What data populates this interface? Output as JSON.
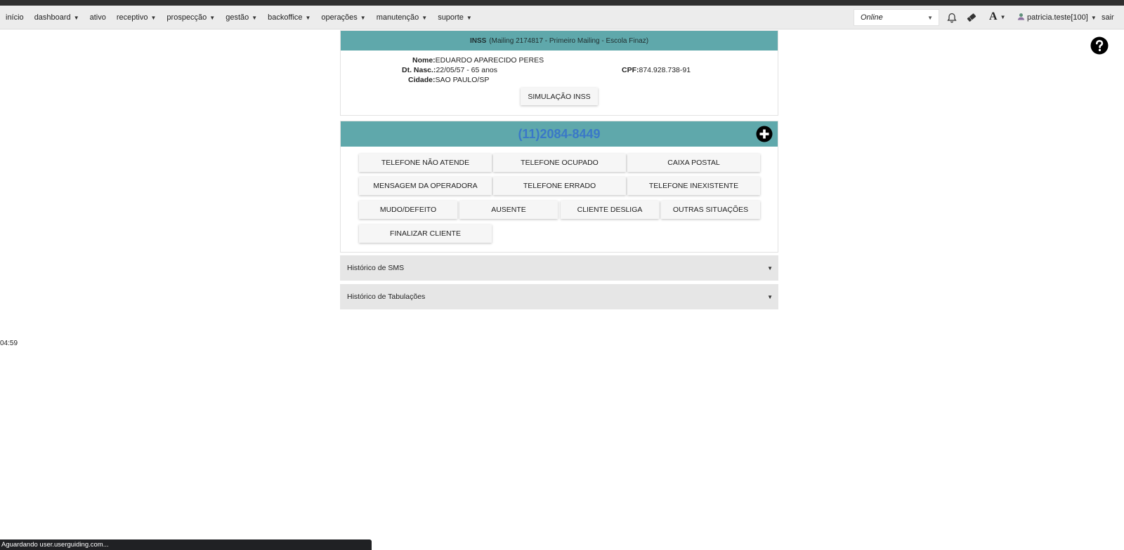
{
  "nav": {
    "items": [
      {
        "label": "início",
        "caret": false
      },
      {
        "label": "dashboard",
        "caret": true
      },
      {
        "label": "ativo",
        "caret": false
      },
      {
        "label": "receptivo",
        "caret": true
      },
      {
        "label": "prospecção",
        "caret": true
      },
      {
        "label": "gestão",
        "caret": true
      },
      {
        "label": "backoffice",
        "caret": true
      },
      {
        "label": "operações",
        "caret": true
      },
      {
        "label": "manutenção",
        "caret": true
      },
      {
        "label": "suporte",
        "caret": true
      }
    ],
    "status": "Online",
    "font_label": "A",
    "user": "patricia.teste[100]",
    "logout": "sair"
  },
  "client_card": {
    "title": "INSS",
    "subtitle": "(Mailing 2174817 - Primeiro Mailing - Escola Finaz)",
    "name_label": "Nome:",
    "name": "EDUARDO APARECIDO PERES",
    "birth_label": "Dt. Nasc.:",
    "birth": "22/05/57 - 65 anos",
    "city_label": "Cidade:",
    "city": "SAO PAULO/SP",
    "cpf_label": "CPF:",
    "cpf": "874.928.738-91",
    "simulate_button": "SIMULAÇÃO INSS"
  },
  "phone_card": {
    "number": "(11)2084-8449",
    "buttons": {
      "no_answer": "TELEFONE NÃO ATENDE",
      "busy": "TELEFONE OCUPADO",
      "voicemail": "CAIXA POSTAL",
      "operator_msg": "MENSAGEM DA OPERADORA",
      "wrong": "TELEFONE ERRADO",
      "nonexistent": "TELEFONE INEXISTENTE",
      "mute": "MUDO/DEFEITO",
      "absent": "AUSENTE",
      "hangup": "CLIENTE DESLIGA",
      "other": "OUTRAS SITUAÇÕES",
      "finish": "FINALIZAR CLIENTE"
    }
  },
  "accordions": {
    "sms": "Histórico de SMS",
    "tabs": "Histórico de Tabulações"
  },
  "clock": "04:59",
  "browser_status": "Aguardando user.userguiding.com...",
  "colors": {
    "header_teal": "#5fa8ab",
    "phone_blue": "#3a78c8",
    "navbar_bg": "#ececec"
  }
}
